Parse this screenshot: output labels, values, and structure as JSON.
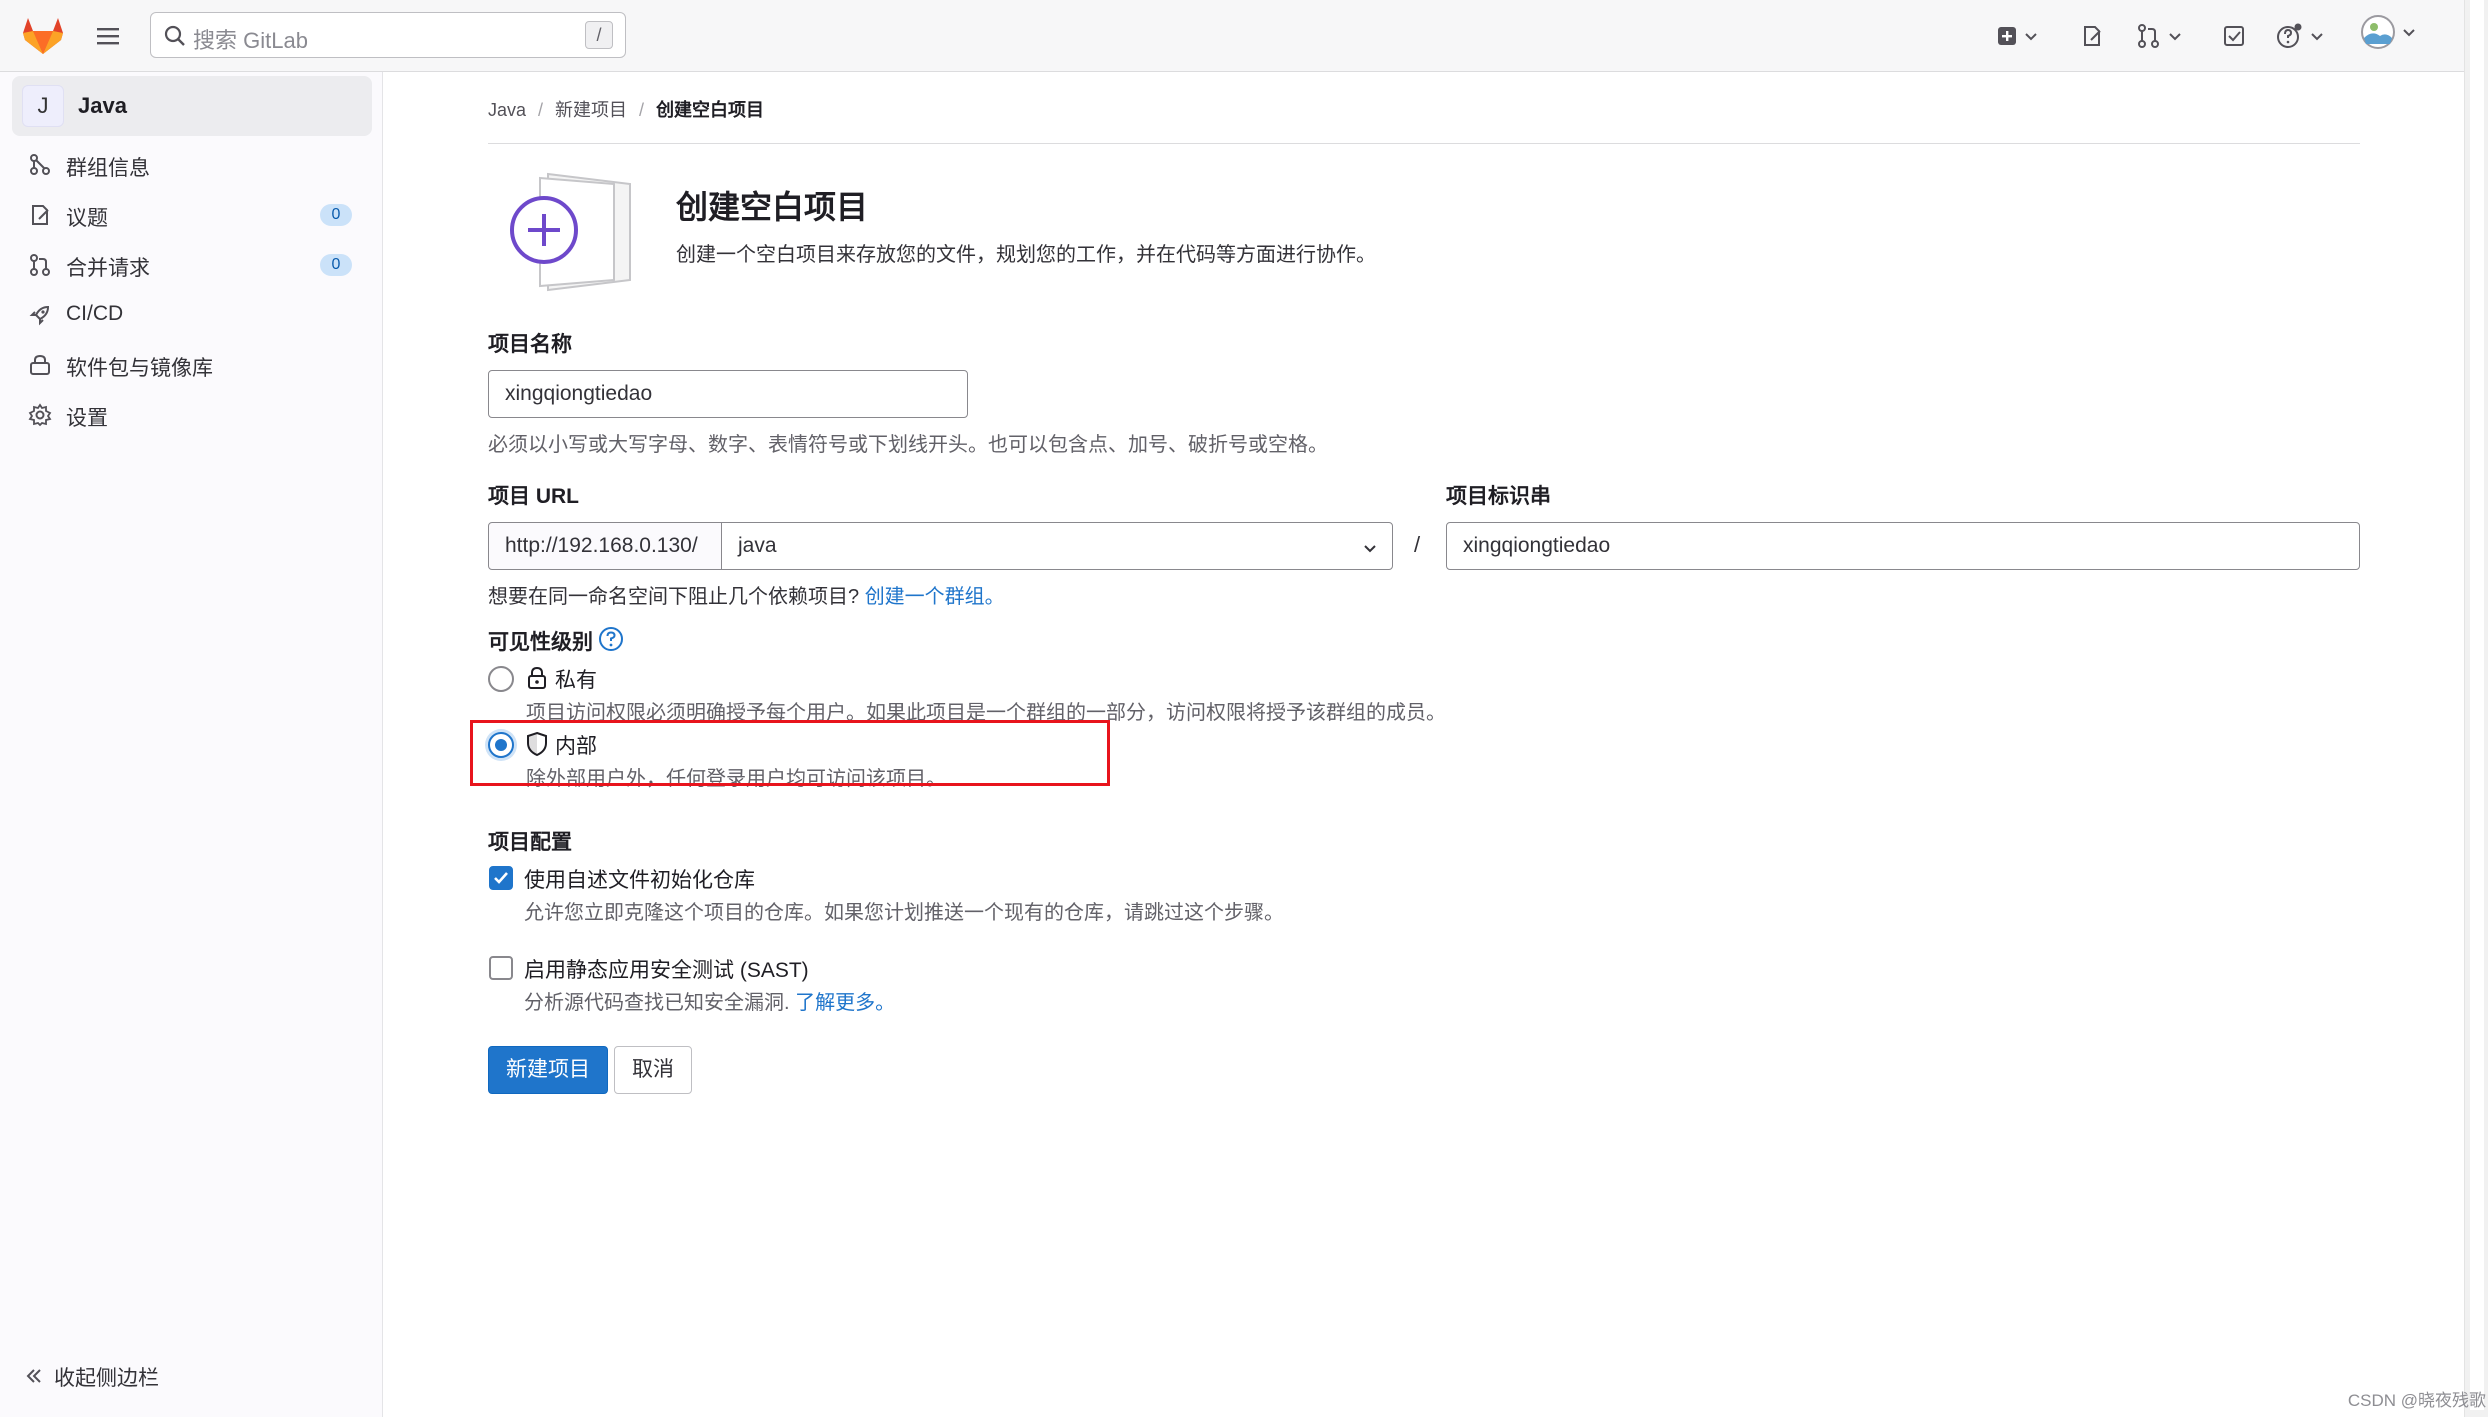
{
  "topbar": {
    "search_placeholder": "搜索 GitLab",
    "search_shortcut": "/",
    "icons": [
      "tanuki-logo",
      "hamburger-menu-icon",
      "search-icon",
      "create-new-icon",
      "issues-icon",
      "merge-requests-icon",
      "todos-icon",
      "help-icon",
      "user-avatar"
    ]
  },
  "sidebar": {
    "project_initial": "J",
    "project_name": "Java",
    "items": [
      {
        "label": "群组信息",
        "icon": "group-info-icon"
      },
      {
        "label": "议题",
        "icon": "issues-icon",
        "count": "0"
      },
      {
        "label": "合并请求",
        "icon": "merge-request-icon",
        "count": "0"
      },
      {
        "label": "CI/CD",
        "icon": "rocket-icon"
      },
      {
        "label": "软件包与镜像库",
        "icon": "package-icon"
      },
      {
        "label": "设置",
        "icon": "settings-icon"
      }
    ],
    "collapse_label": "收起侧边栏"
  },
  "breadcrumb": [
    "Java",
    "新建项目",
    "创建空白项目"
  ],
  "header": {
    "title": "创建空白项目",
    "subtitle": "创建一个空白项目来存放您的文件，规划您的工作，并在代码等方面进行协作。"
  },
  "form": {
    "project_name_label": "项目名称",
    "project_name_value": "xingqiongtiedao",
    "project_name_help": "必须以小写或大写字母、数字、表情符号或下划线开头。也可以包含点、加号、破折号或空格。",
    "url_label": "项目 URL",
    "url_prefix": "http://192.168.0.130/",
    "namespace_value": "java",
    "url_separator": "/",
    "slug_label": "项目标识串",
    "slug_value": "xingqiongtiedao",
    "namespace_help": "想要在同一命名空间下阻止几个依赖项目?",
    "namespace_help_link": "创建一个群组。",
    "visibility_label": "可见性级别",
    "visibility_options": [
      {
        "label": "私有",
        "icon": "lock-icon",
        "desc": "项目访问权限必须明确授予每个用户。如果此项目是一个群组的一部分，访问权限将授予该群组的成员。",
        "selected": false
      },
      {
        "label": "内部",
        "icon": "shield-icon",
        "desc": "除外部用户外，任何登录用户均可访问该项目。",
        "selected": true
      }
    ],
    "config_label": "项目配置",
    "config_options": [
      {
        "label": "使用自述文件初始化仓库",
        "desc": "允许您立即克隆这个项目的仓库。如果您计划推送一个现有的仓库，请跳过这个步骤。",
        "checked": true
      },
      {
        "label": "启用静态应用安全测试 (SAST)",
        "desc": "分析源代码查找已知安全漏洞.",
        "link": "了解更多。",
        "checked": false
      }
    ],
    "submit_label": "新建项目",
    "cancel_label": "取消"
  },
  "watermark": "CSDN @晓夜残歌",
  "colors": {
    "accent": "#1f75cb",
    "highlight_box": "#e8141d"
  }
}
